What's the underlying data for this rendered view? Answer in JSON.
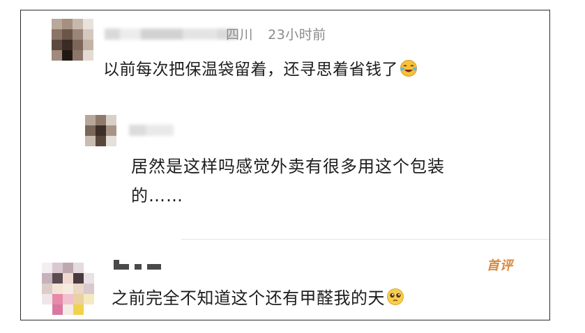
{
  "comments": [
    {
      "location": "四川",
      "time": "23小时前",
      "text": "以前每次把保温袋留着，还寻思着省钱了",
      "emoji": "laughing-crying-emoji",
      "reply": {
        "text": "居然是这样吗感觉外卖有很多用这个包装的……",
        "line1": "居然是这样吗感觉外卖有很多用这个包装",
        "line2": "的……"
      }
    },
    {
      "badge": "首评",
      "text": "之前完全不知道这个还有甲醛我的天",
      "emoji": "pleading-face-emoji"
    }
  ]
}
